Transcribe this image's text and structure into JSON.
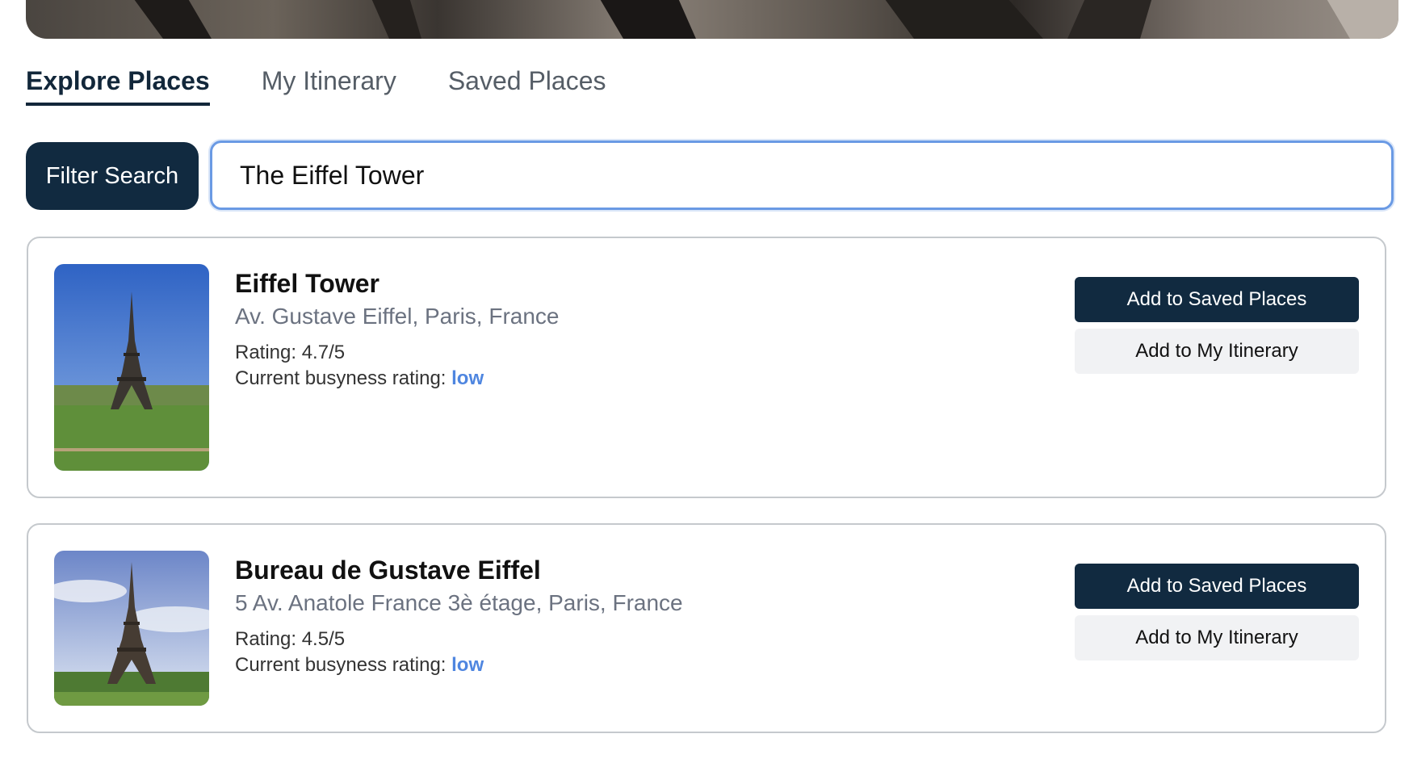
{
  "tabs": [
    {
      "label": "Explore Places",
      "active": true
    },
    {
      "label": "My Itinerary",
      "active": false
    },
    {
      "label": "Saved Places",
      "active": false
    }
  ],
  "search": {
    "filter_button_label": "Filter Search",
    "query": "The Eiffel Tower"
  },
  "places": [
    {
      "name": "Eiffel Tower",
      "address": "Av. Gustave Eiffel, Paris, France",
      "rating": "Rating: 4.7/5",
      "busyness_label": "Current busyness rating: ",
      "busyness_value": "low",
      "save_label": "Add to Saved Places",
      "itinerary_label": "Add to My Itinerary"
    },
    {
      "name": "Bureau de Gustave Eiffel",
      "address": "5 Av. Anatole France 3è étage, Paris, France",
      "rating": "Rating: 4.5/5",
      "busyness_label": "Current busyness rating: ",
      "busyness_value": "low",
      "save_label": "Add to Saved Places",
      "itinerary_label": "Add to My Itinerary"
    }
  ],
  "colors": {
    "primary_navy": "#112a40",
    "busyness_low": "#4f86e0",
    "focus_ring": "#6a9ae4"
  }
}
